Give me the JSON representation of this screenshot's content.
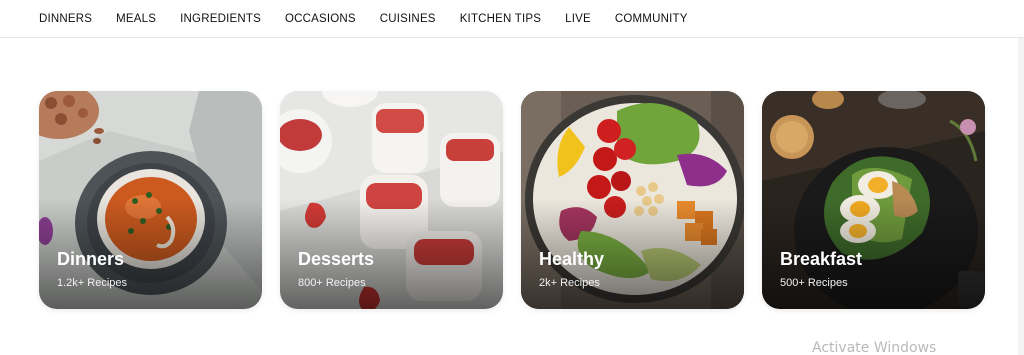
{
  "nav": {
    "items": [
      "DINNERS",
      "MEALS",
      "INGREDIENTS",
      "OCCASIONS",
      "CUISINES",
      "KITCHEN TIPS",
      "LIVE",
      "COMMUNITY"
    ]
  },
  "cards": [
    {
      "title": "Dinners",
      "count": "1.2k+ Recipes",
      "image": "tomato-soup-bowl"
    },
    {
      "title": "Desserts",
      "count": "800+ Recipes",
      "image": "strawberry-parfait-jars"
    },
    {
      "title": "Healthy",
      "count": "2k+ Recipes",
      "image": "salad-bowl"
    },
    {
      "title": "Breakfast",
      "count": "500+ Recipes",
      "image": "egg-avocado-toast"
    }
  ],
  "watermark": "Activate Windows"
}
